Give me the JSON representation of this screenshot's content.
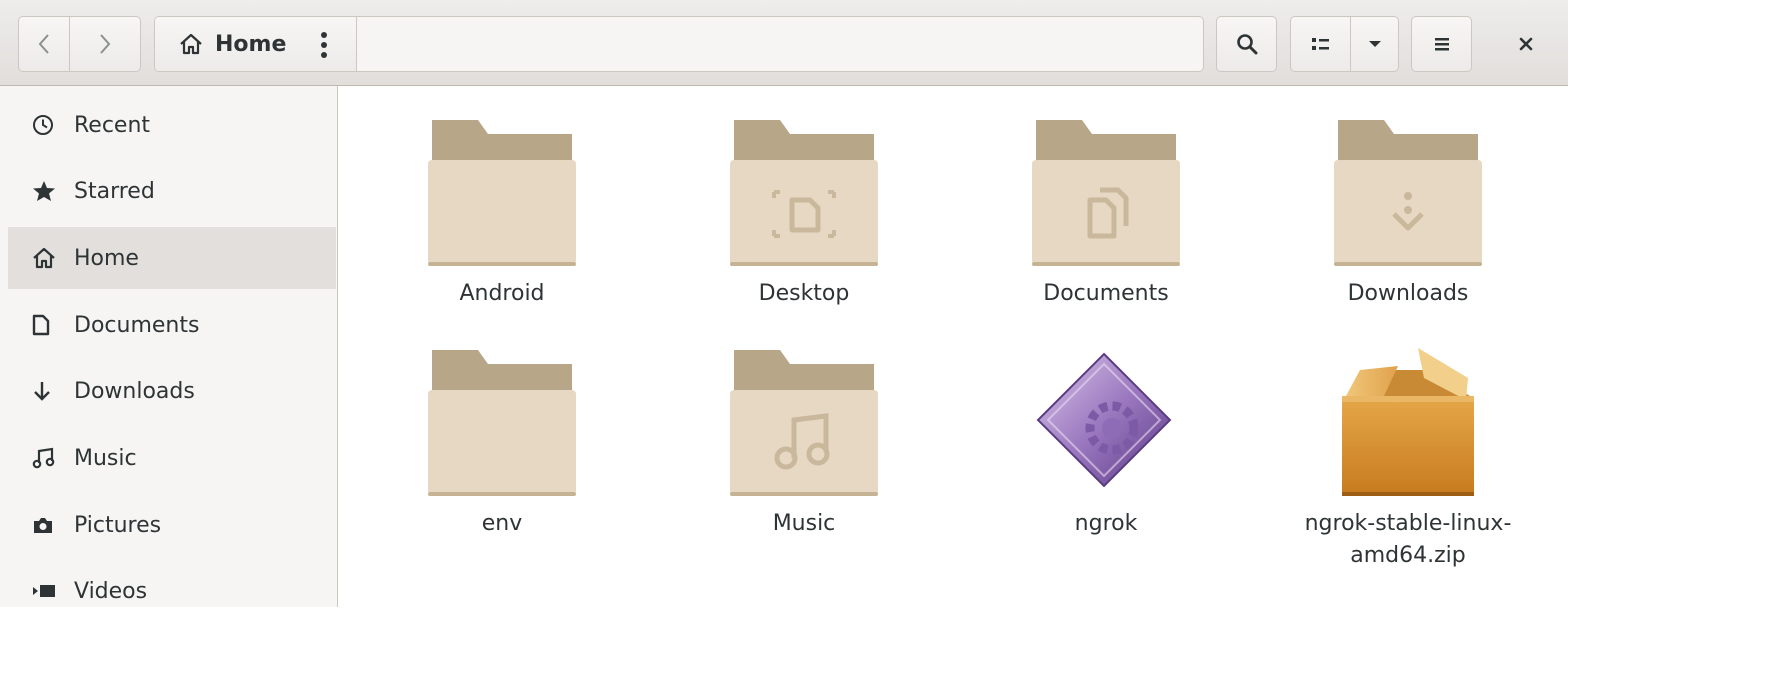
{
  "toolbar": {
    "path_home_label": "Home"
  },
  "sidebar": {
    "items": [
      {
        "label": "Recent",
        "icon": "clock-icon"
      },
      {
        "label": "Starred",
        "icon": "star-icon"
      },
      {
        "label": "Home",
        "icon": "home-icon",
        "selected": true
      },
      {
        "label": "Documents",
        "icon": "document-icon"
      },
      {
        "label": "Downloads",
        "icon": "download-arrow-icon"
      },
      {
        "label": "Music",
        "icon": "music-note-icon"
      },
      {
        "label": "Pictures",
        "icon": "camera-icon"
      },
      {
        "label": "Videos",
        "icon": "video-icon"
      }
    ]
  },
  "files": [
    {
      "name": "Android",
      "type": "folder"
    },
    {
      "name": "Desktop",
      "type": "folder-desktop"
    },
    {
      "name": "Documents",
      "type": "folder-documents"
    },
    {
      "name": "Downloads",
      "type": "folder-downloads"
    },
    {
      "name": "env",
      "type": "folder"
    },
    {
      "name": "Music",
      "type": "folder-music"
    },
    {
      "name": "ngrok",
      "type": "executable"
    },
    {
      "name": "ngrok-stable-linux-\namd64.zip",
      "type": "archive"
    }
  ],
  "colors": {
    "folder_back": "#b8a689",
    "folder_front": "#e6d8c2",
    "folder_emblem": "#c9b89c",
    "selected_row": "#e2dfdc"
  }
}
